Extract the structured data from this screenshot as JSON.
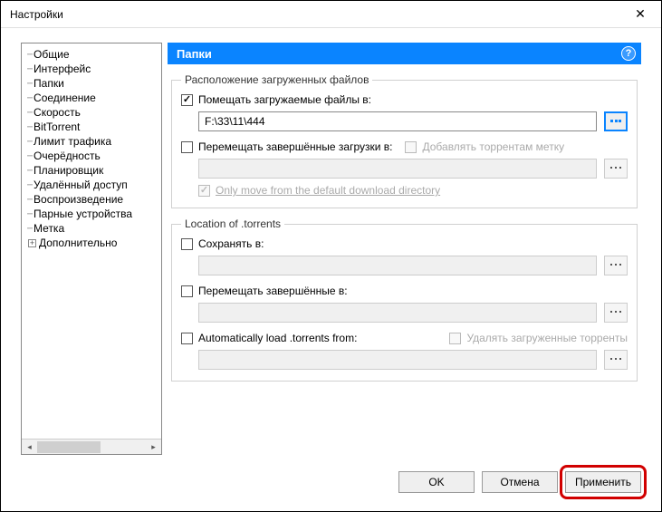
{
  "window": {
    "title": "Настройки"
  },
  "tree": {
    "items": [
      {
        "label": "Общие"
      },
      {
        "label": "Интерфейс"
      },
      {
        "label": "Папки"
      },
      {
        "label": "Соединение"
      },
      {
        "label": "Скорость"
      },
      {
        "label": "BitTorrent"
      },
      {
        "label": "Лимит трафика"
      },
      {
        "label": "Очерёдность"
      },
      {
        "label": "Планировщик"
      },
      {
        "label": "Удалённый доступ"
      },
      {
        "label": "Воспроизведение"
      },
      {
        "label": "Парные устройства"
      },
      {
        "label": "Метка"
      },
      {
        "label": "Дополнительно"
      }
    ]
  },
  "content": {
    "header": "Папки",
    "group1": {
      "legend": "Расположение загруженных файлов",
      "put_in_label": "Помещать загружаемые файлы в:",
      "put_in_path": "F:\\33\\11\\444",
      "move_completed_label": "Перемещать завершённые загрузки в:",
      "add_label_label": "Добавлять торрентам метку",
      "only_move_label": "Only move from the default download directory"
    },
    "group2": {
      "legend": "Location of .torrents",
      "save_in_label": "Сохранять в:",
      "move_completed_label": "Перемещать завершённые в:",
      "autoload_label": "Automatically load .torrents from:",
      "delete_label": "Удалять загруженные торренты"
    }
  },
  "buttons": {
    "ok": "OK",
    "cancel": "Отмена",
    "apply": "Применить"
  }
}
